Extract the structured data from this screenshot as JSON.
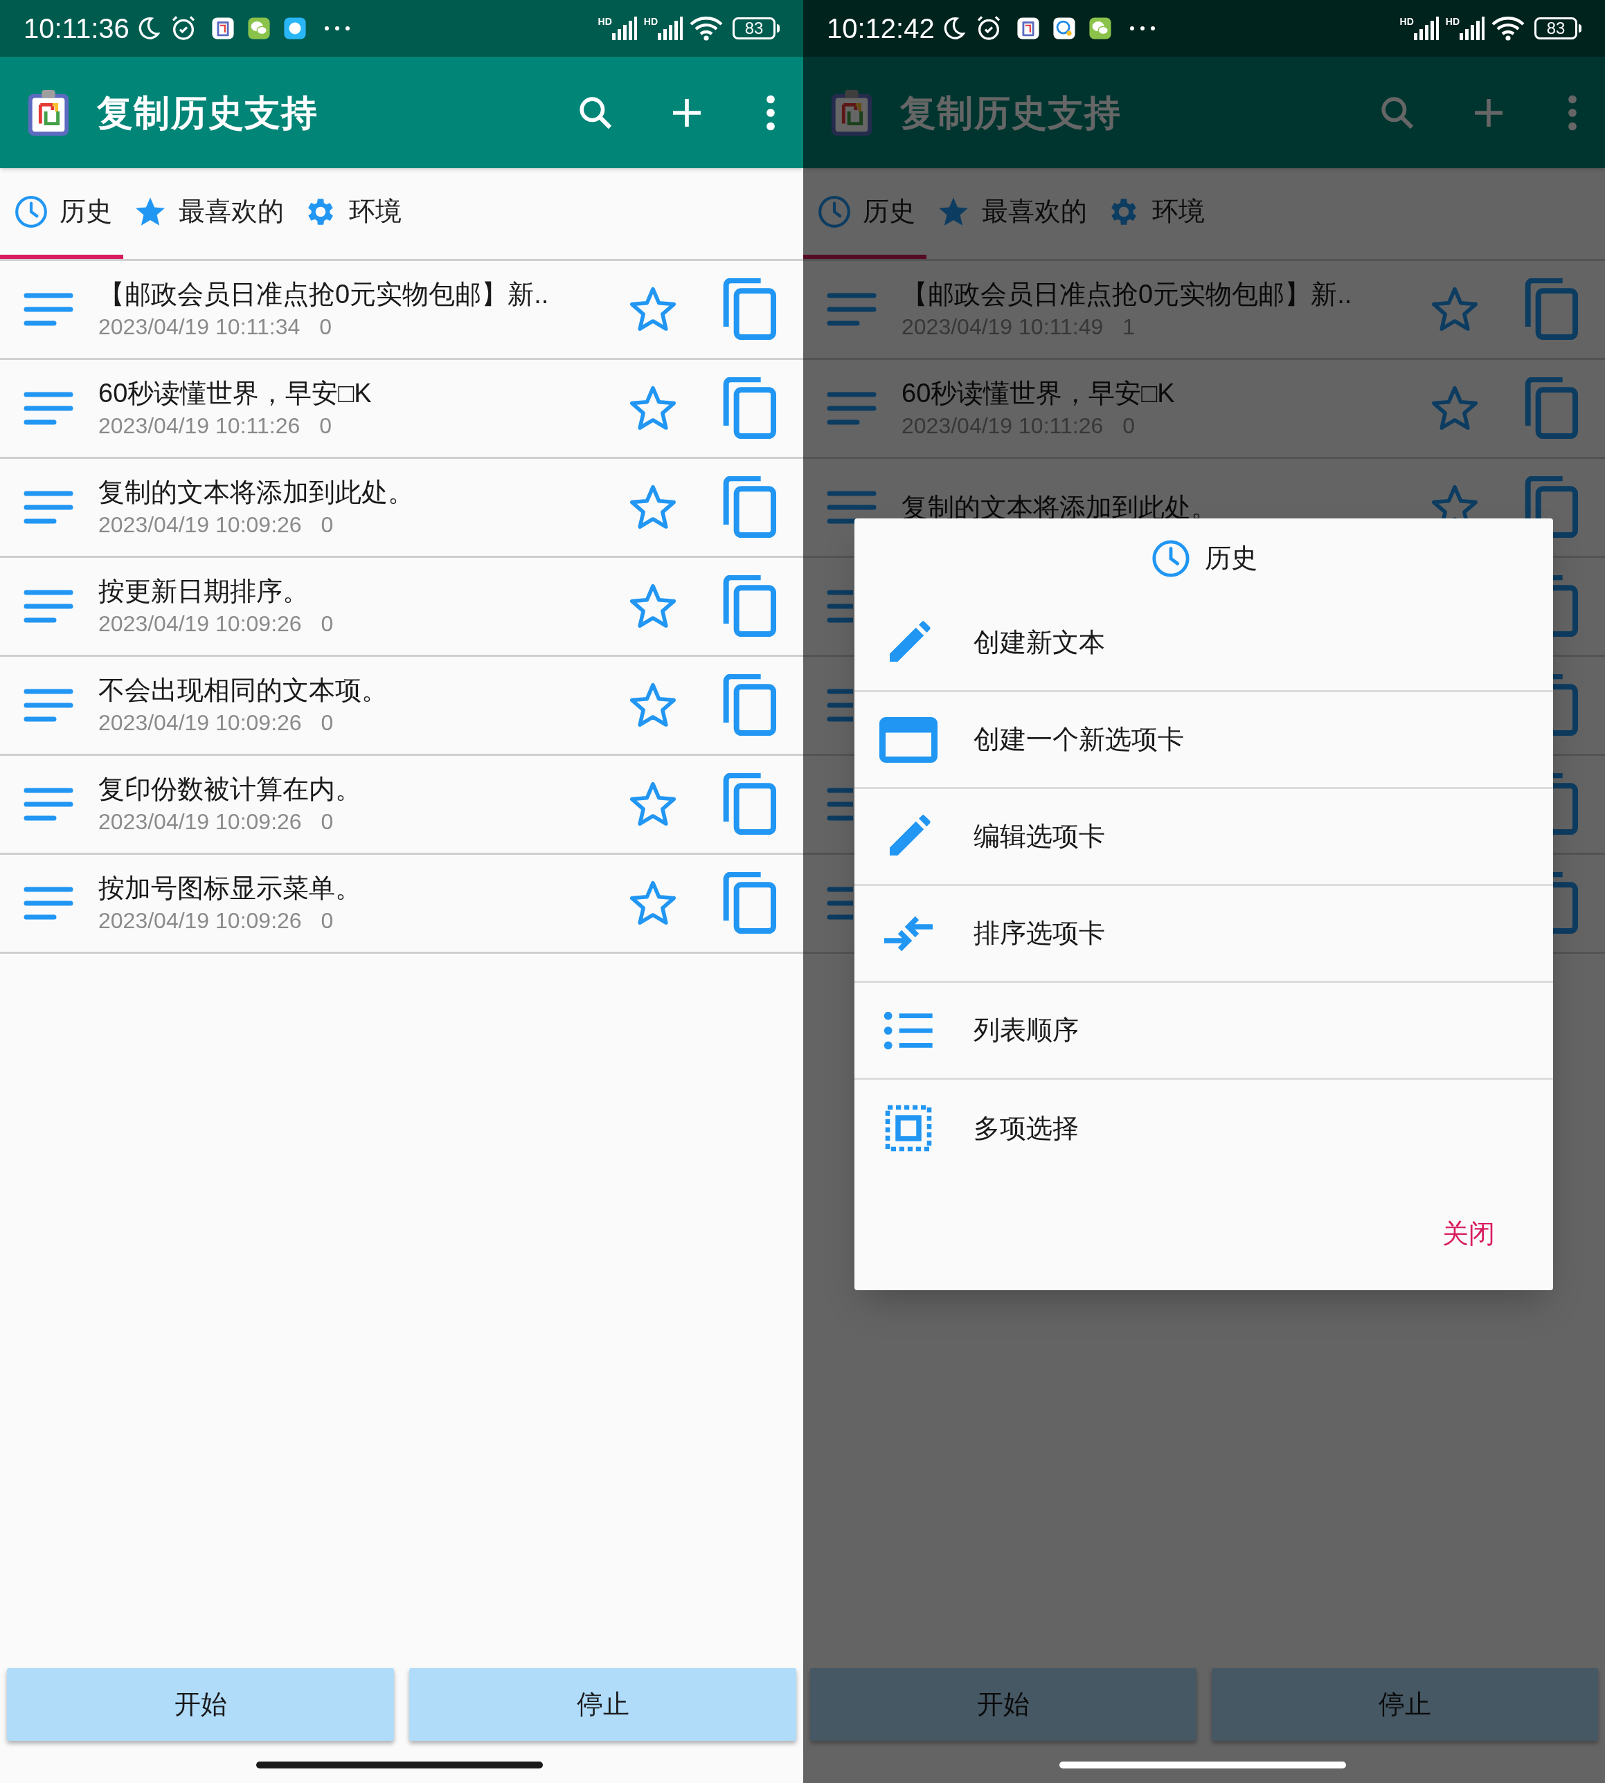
{
  "screens": [
    {
      "dimmed": false,
      "status_bar": {
        "time": "10:11:36",
        "notifications": [
          {
            "kind": "clipboard"
          },
          {
            "kind": "wechat"
          },
          {
            "kind": "bubble"
          }
        ],
        "network_labels": [
          "HD",
          "HD"
        ],
        "battery": "83"
      },
      "app_bar": {
        "title": "复制历史支持"
      },
      "tabs": [
        {
          "label": "历史",
          "kind": "clock",
          "selected": true
        },
        {
          "label": "最喜欢的",
          "kind": "star",
          "selected": false
        },
        {
          "label": "环境",
          "kind": "gear",
          "selected": false
        }
      ],
      "rows": [
        {
          "kind": "entry",
          "title": "【邮政会员日准点抢0元实物包邮】新..",
          "timestamp": "2023/04/19 10:11:34",
          "count": "0"
        },
        {
          "kind": "entry",
          "title": "60秒读懂世界，早安□K",
          "timestamp": "2023/04/19 10:11:26",
          "count": "0"
        },
        {
          "kind": "entry",
          "title": "复制的文本将添加到此处。",
          "timestamp": "2023/04/19 10:09:26",
          "count": "0"
        },
        {
          "kind": "entry",
          "title": "按更新日期排序。",
          "timestamp": "2023/04/19 10:09:26",
          "count": "0"
        },
        {
          "kind": "entry",
          "title": "不会出现相同的文本项。",
          "timestamp": "2023/04/19 10:09:26",
          "count": "0"
        },
        {
          "kind": "entry",
          "title": "复印份数被计算在内。",
          "timestamp": "2023/04/19 10:09:26",
          "count": "0"
        },
        {
          "kind": "entry",
          "title": "按加号图标显示菜单。",
          "timestamp": "2023/04/19 10:09:26",
          "count": "0"
        }
      ],
      "buttons": [
        "开始",
        "停止"
      ]
    },
    {
      "dimmed": true,
      "status_bar": {
        "time": "10:12:42",
        "notifications": [
          {
            "kind": "clipboard"
          },
          {
            "kind": "chat"
          },
          {
            "kind": "wechat"
          }
        ],
        "network_labels": [
          "HD",
          "HD"
        ],
        "battery": "83"
      },
      "app_bar": {
        "title": "复制历史支持"
      },
      "tabs": [
        {
          "label": "历史",
          "kind": "clock",
          "selected": true
        },
        {
          "label": "最喜欢的",
          "kind": "star",
          "selected": false
        },
        {
          "label": "环境",
          "kind": "gear",
          "selected": false
        }
      ],
      "rows": [
        {
          "kind": "entry",
          "title": "【邮政会员日准点抢0元实物包邮】新..",
          "timestamp": "2023/04/19 10:11:49",
          "count": "1"
        },
        {
          "kind": "entry",
          "title": "60秒读懂世界，早安□K",
          "timestamp": "2023/04/19 10:11:26",
          "count": "0"
        },
        {
          "kind": "entry",
          "title": "复制的文本将添加到此处。"
        },
        {
          "kind": "covered"
        },
        {
          "kind": "covered"
        },
        {
          "kind": "covered"
        },
        {
          "kind": "covered"
        }
      ],
      "buttons": [
        "开始",
        "停止"
      ],
      "dialog": {
        "title": "历史",
        "items": [
          {
            "kind": "pencil",
            "label": "创建新文本"
          },
          {
            "kind": "tab",
            "label": "创建一个新选项卡"
          },
          {
            "kind": "pencil",
            "label": "编辑选项卡"
          },
          {
            "kind": "sort",
            "label": "排序选项卡"
          },
          {
            "kind": "list",
            "label": "列表顺序"
          },
          {
            "kind": "select",
            "label": "多项选择"
          }
        ],
        "close": "关闭"
      }
    }
  ]
}
